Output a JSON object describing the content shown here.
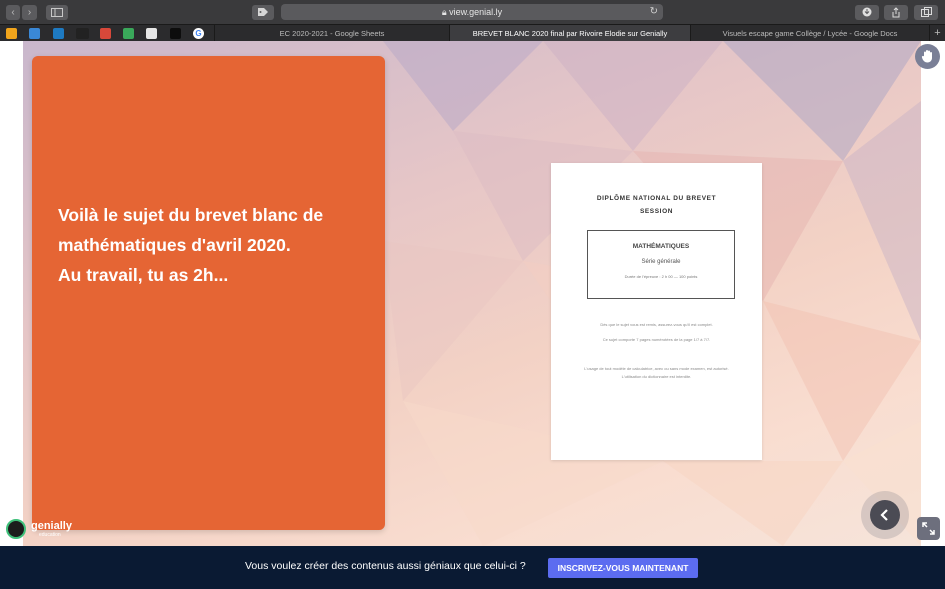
{
  "browser": {
    "url": "view.genial.ly",
    "back_icon": "‹",
    "forward_icon": "›",
    "tabs": [
      {
        "label": "EC 2020-2021 - Google Sheets"
      },
      {
        "label": "BREVET BLANC 2020 final par Rivoire Elodie sur Genially"
      },
      {
        "label": "Visuels escape game Collège / Lycée - Google Docs"
      }
    ],
    "new_tab_label": "+",
    "bookmark_colors": [
      "#f2a51c",
      "#3a88d6",
      "#1e7ac2",
      "#222222",
      "#d8483a",
      "#3aa85a",
      "#e6e6e6",
      "#0d0d0d"
    ],
    "bookmark_labels": [
      "",
      "",
      "",
      "",
      "",
      "",
      "",
      "G"
    ]
  },
  "slide": {
    "card_lines": [
      "Voilà le sujet du brevet blanc de",
      "mathématiques d'avril 2020.",
      "Au travail, tu as 2h..."
    ],
    "document": {
      "title_line1": "DIPLÔME NATIONAL DU BREVET",
      "title_line2": "SESSION",
      "subject": "MATHÉMATIQUES",
      "series": "Série générale",
      "duration": "Durée de l'épreuve : 2 h 00   —   100 points",
      "note1": "Dès que le sujet vous est remis, assurez-vous qu'il est complet.",
      "note2": "Ce sujet comporte 7 pages numérotées de la page 1/7 à 7/7.",
      "note3": "L'usage de tout modèle de calculatrice, avec ou sans mode examen, est autorisé.",
      "note4": "L'utilisation du dictionnaire est interdite."
    },
    "logo_name": "genially",
    "logo_sub": "education"
  },
  "footer": {
    "text": "Vous voulez créer des contenus aussi géniaux que celui-ci ?",
    "cta_label": "INSCRIVEZ-VOUS MAINTENANT"
  },
  "colors": {
    "card": "#e56534",
    "cta": "#5c6cf0",
    "footer_bg": "#0a1a33"
  }
}
